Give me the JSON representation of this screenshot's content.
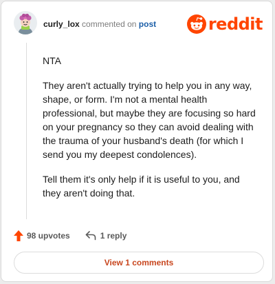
{
  "header": {
    "username": "curly_lox",
    "verb": "commented on",
    "post_link": "post",
    "brand": "reddit"
  },
  "comment": {
    "paragraphs": [
      "NTA",
      "They aren't actually trying to help you in any way, shape, or form. I'm not a mental health professional, but maybe they are focusing so hard on your pregnancy so they can avoid dealing with the trauma of your husband's death (for which I send you my deepest condolences).",
      "Tell them it's only help if it is useful to you, and they aren't doing that."
    ]
  },
  "actions": {
    "upvotes": "98 upvotes",
    "replies": "1 reply"
  },
  "footer": {
    "view_comments": "View 1 comments"
  },
  "icons": {
    "avatar": "user-avatar-icon",
    "logo": "reddit-alien-icon",
    "upvote": "upvote-arrow-icon",
    "reply": "reply-arrow-icon"
  },
  "colors": {
    "brand": "#ff4500",
    "link": "#1c5fa8",
    "view_button_text": "#c8461e"
  }
}
